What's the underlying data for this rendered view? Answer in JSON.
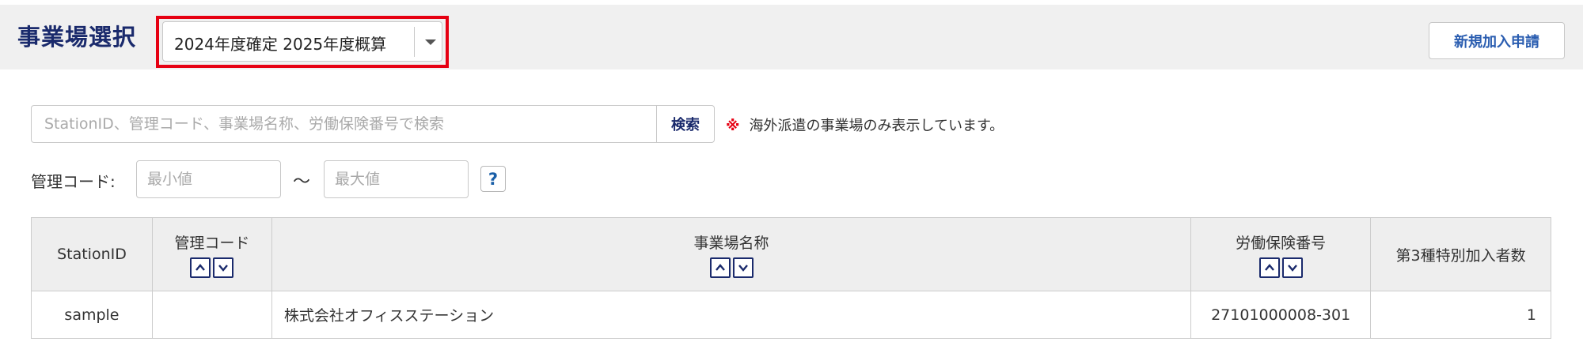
{
  "header": {
    "title": "事業場選択",
    "year_select": {
      "value": "2024年度確定 2025年度概算"
    },
    "new_application_label": "新規加入申請"
  },
  "search": {
    "placeholder": "StationID、管理コード、事業場名称、労働保険番号で検索",
    "button_label": "検索",
    "notice_mark": "※",
    "notice_text": "海外派遣の事業場のみ表示しています。"
  },
  "filter": {
    "code_label": "管理コード:",
    "min_placeholder": "最小値",
    "range_separator": "～",
    "max_placeholder": "最大値",
    "help_label": "?"
  },
  "table": {
    "columns": [
      "StationID",
      "管理コード",
      "事業場名称",
      "労働保険番号",
      "第3種特別加入者数"
    ],
    "rows": [
      [
        "sample",
        "",
        "株式会社オフィスステーション",
        "27101000008-301",
        "1"
      ]
    ]
  },
  "colors": {
    "header_bg": "#f0f0f0",
    "title": "#1a2a6c",
    "highlight": "#e60012",
    "link_blue": "#2a5db0"
  },
  "icons": [
    "caret-down-icon",
    "sort-asc-icon",
    "sort-desc-icon",
    "help-icon"
  ]
}
